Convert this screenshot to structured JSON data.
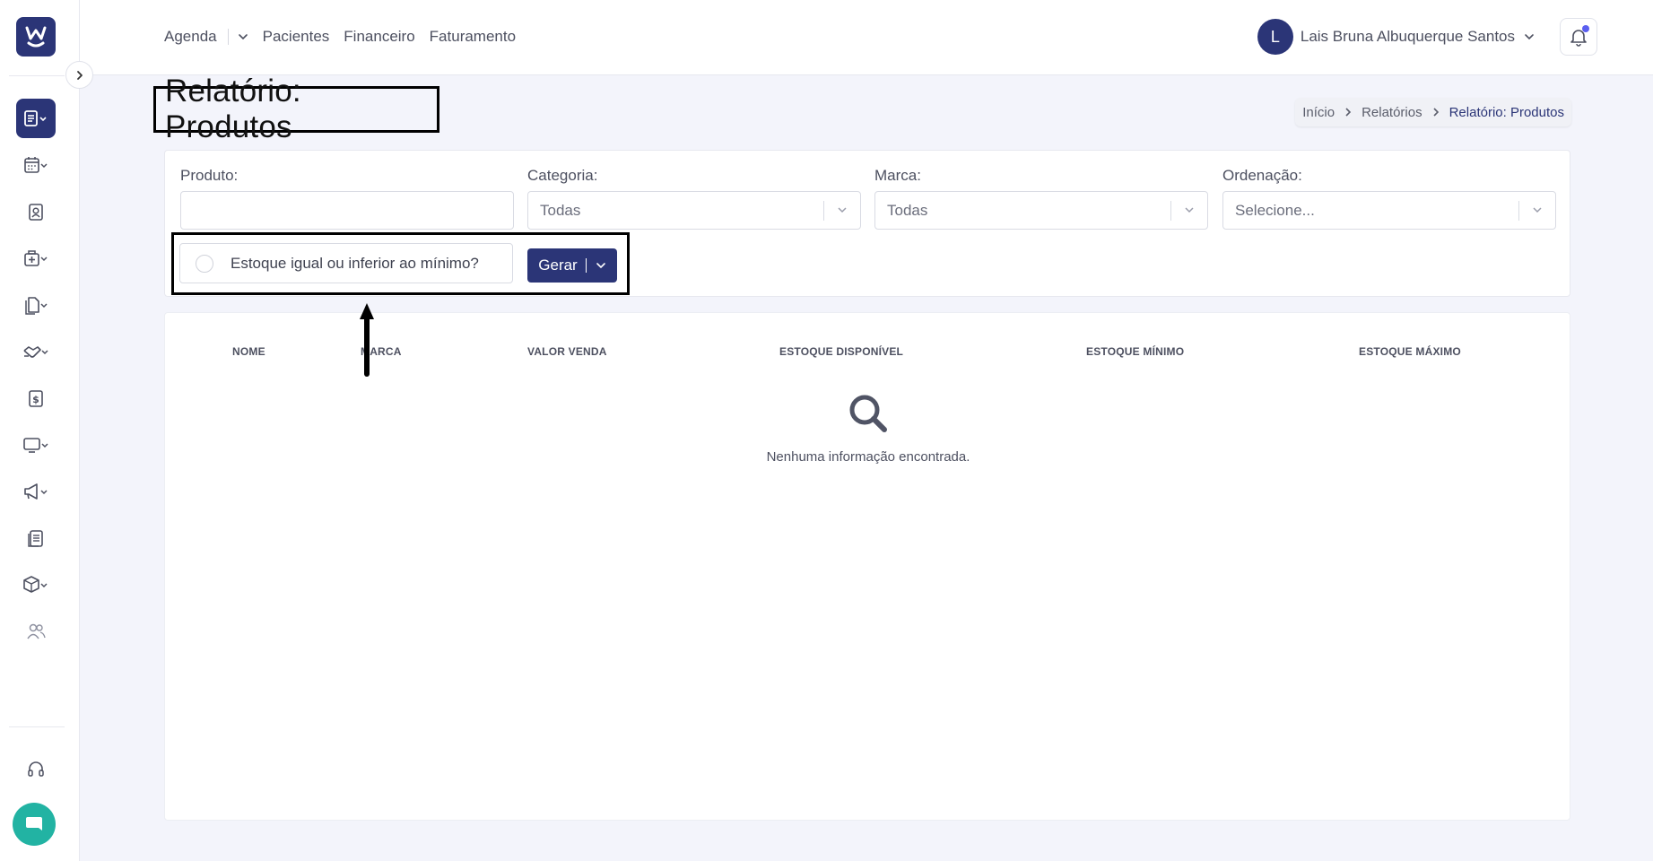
{
  "topbar": {
    "nav": [
      {
        "label": "Agenda"
      },
      {
        "label": "Pacientes"
      },
      {
        "label": "Financeiro"
      },
      {
        "label": "Faturamento"
      }
    ],
    "user_initial": "L",
    "user_name": "Lais Bruna Albuquerque Santos"
  },
  "page": {
    "title": "Relatório: Produtos",
    "breadcrumb": [
      "Início",
      "Relatórios",
      "Relatório: Produtos"
    ]
  },
  "filters": {
    "produto_label": "Produto:",
    "produto_value": "",
    "categoria_label": "Categoria:",
    "categoria_value": "Todas",
    "marca_label": "Marca:",
    "marca_value": "Todas",
    "ordenacao_label": "Ordenação:",
    "ordenacao_placeholder": "Selecione...",
    "estoque_checkbox_label": "Estoque igual ou inferior ao mínimo?",
    "estoque_checked": false,
    "gerar_label": "Gerar"
  },
  "table": {
    "columns": [
      "NOME",
      "MARCA",
      "VALOR VENDA",
      "ESTOQUE DISPONÍVEL",
      "ESTOQUE MÍNIMO",
      "ESTOQUE MÁXIMO"
    ],
    "rows": [],
    "empty_message": "Nenhuma informação encontrada."
  },
  "sidebar": {
    "icons": [
      "reports-icon",
      "calendar-icon",
      "patient-card-icon",
      "clinic-icon",
      "documents-icon",
      "handshake-icon",
      "billing-icon",
      "monitor-icon",
      "megaphone-icon",
      "records-icon",
      "box-icon",
      "users-icon"
    ],
    "support_icon": "headset-icon",
    "chat_icon": "chat-icon"
  },
  "colors": {
    "primary": "#2b3577",
    "chat": "#22b3a3",
    "notification_dot": "#5b5ff0"
  }
}
